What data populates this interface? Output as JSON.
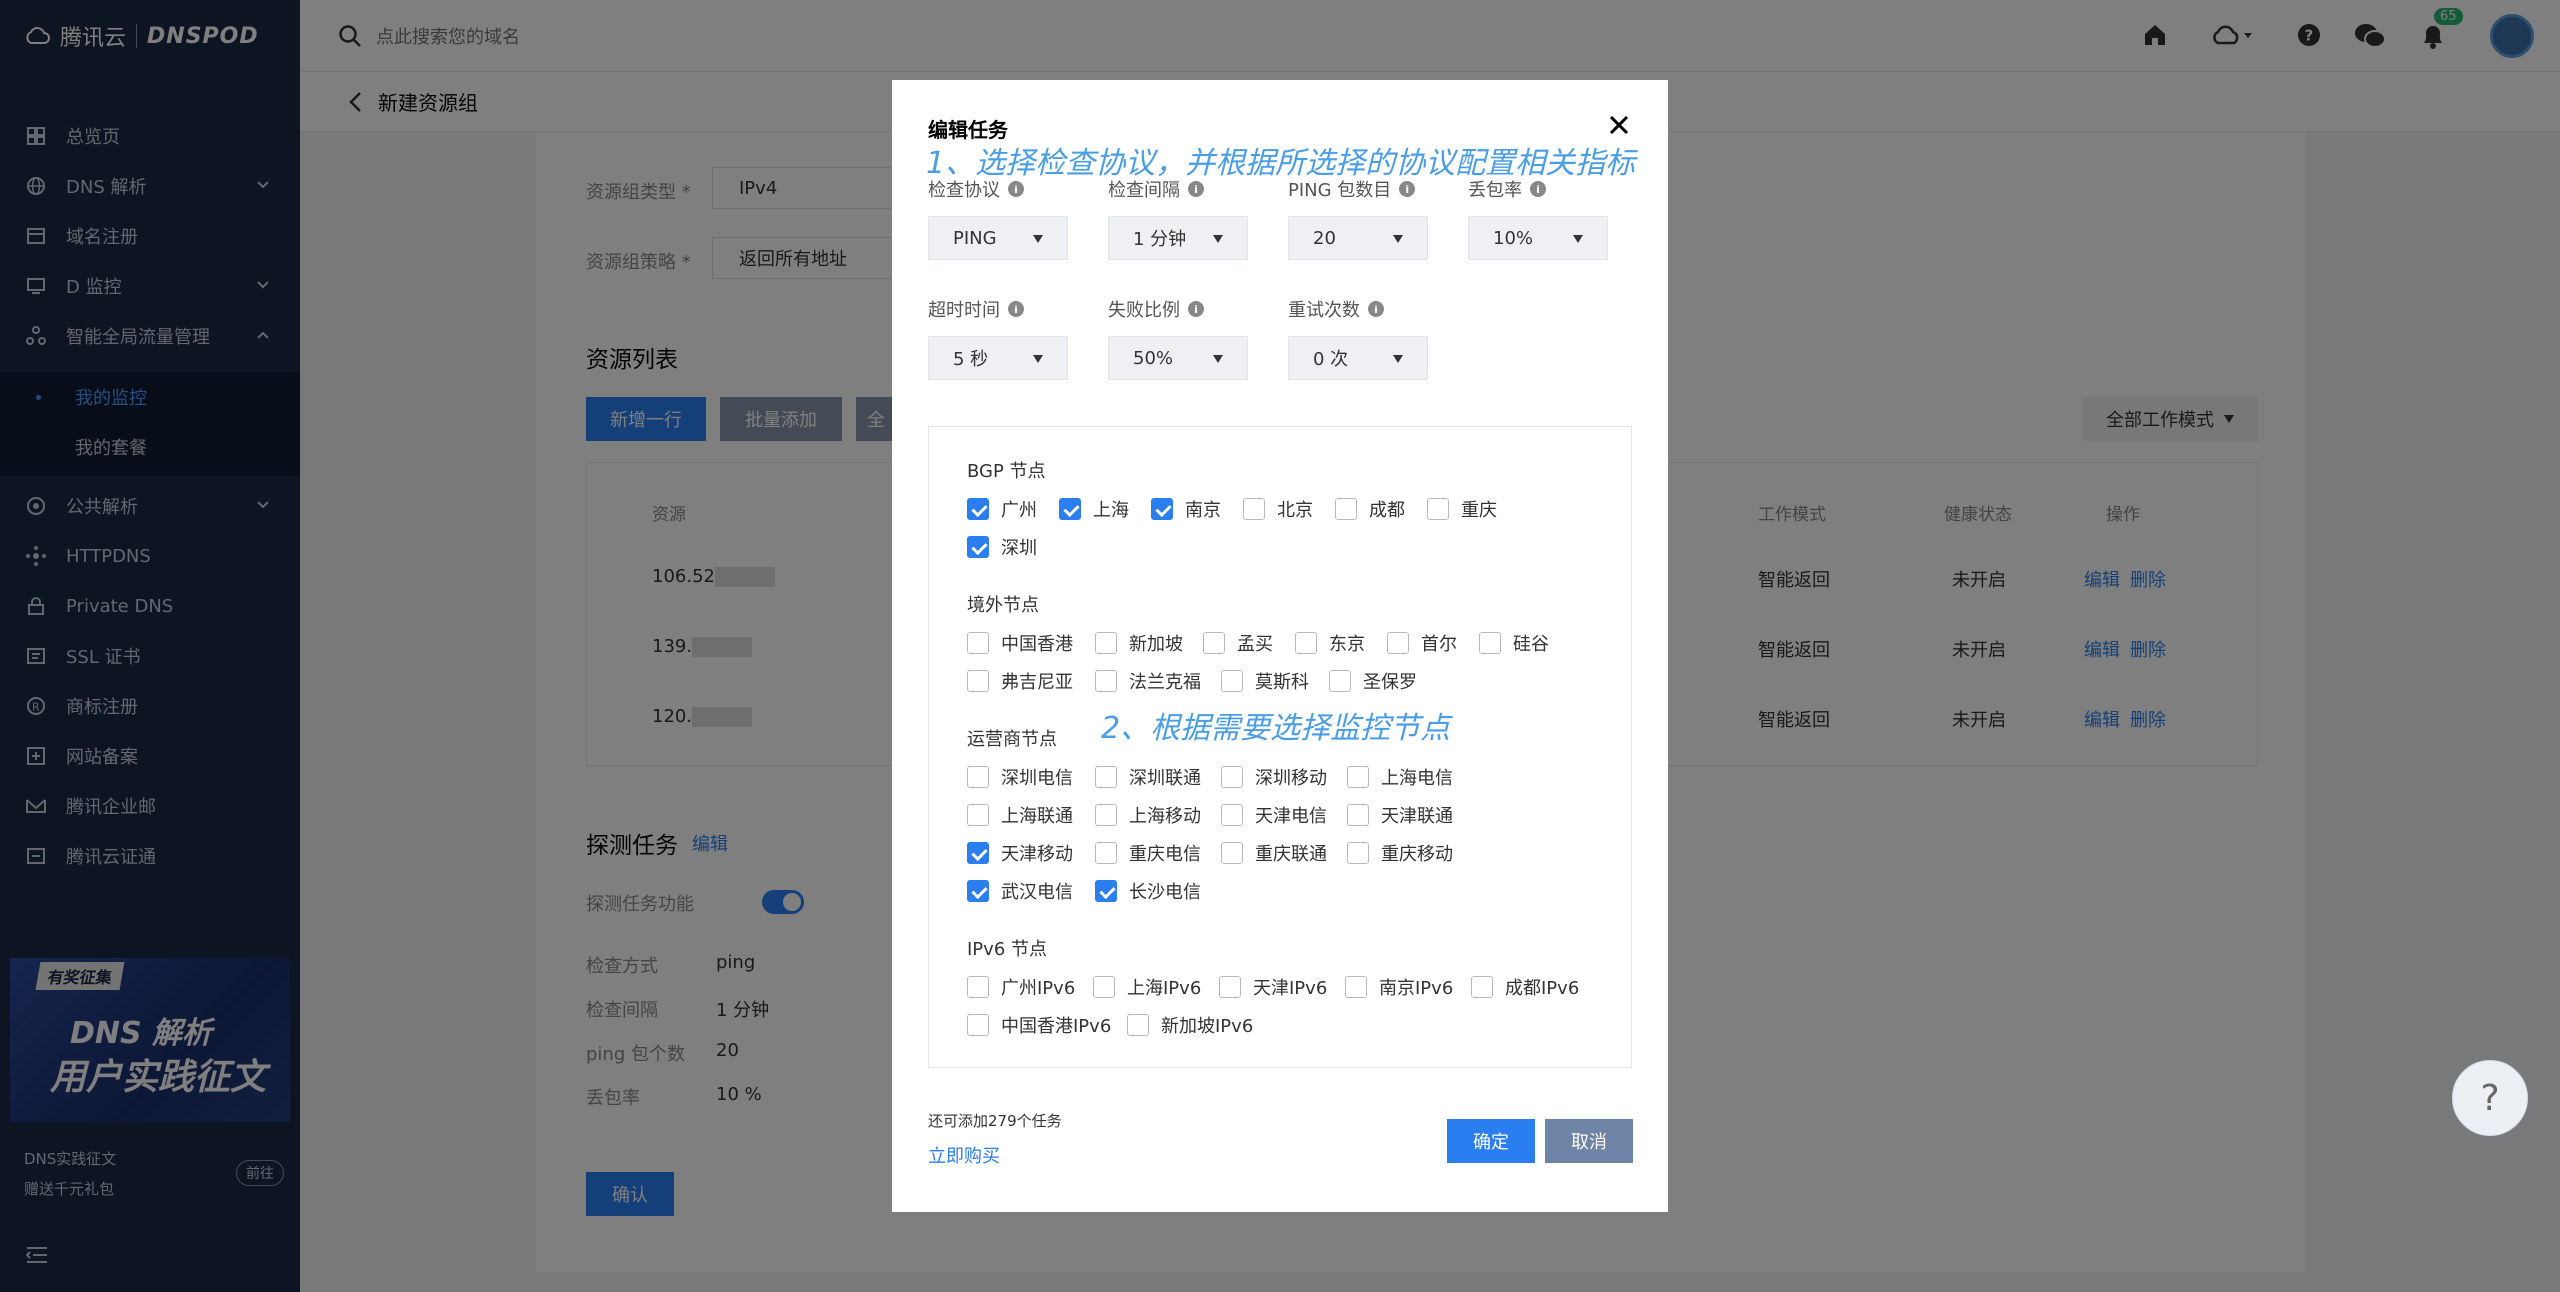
{
  "brand": {
    "name1": "腾讯云",
    "name2": "DNSPOD"
  },
  "sidebar": {
    "items": [
      {
        "label": "总览页"
      },
      {
        "label": "DNS 解析"
      },
      {
        "label": "域名注册"
      },
      {
        "label": "D 监控"
      },
      {
        "label": "智能全局流量管理"
      },
      {
        "label": "公共解析"
      },
      {
        "label": "HTTPDNS"
      },
      {
        "label": "Private DNS"
      },
      {
        "label": "SSL 证书"
      },
      {
        "label": "商标注册"
      },
      {
        "label": "网站备案"
      },
      {
        "label": "腾讯企业邮"
      },
      {
        "label": "腾讯云证通"
      }
    ],
    "subitems": [
      {
        "label": "我的监控"
      },
      {
        "label": "我的套餐"
      }
    ],
    "promo": {
      "tag": "有奖征集",
      "title1": "DNS 解析",
      "title2": "用户实践征文",
      "line1": "DNS实践征文",
      "line2": "赠送千元礼包",
      "button": "前往"
    }
  },
  "header": {
    "search_placeholder": "点此搜索您的域名",
    "notification_count": "65"
  },
  "page": {
    "back_title": "新建资源组",
    "type_label": "资源组类型 *",
    "type_value": "IPv4",
    "strategy_label": "资源组策略 *",
    "strategy_value": "返回所有地址",
    "list_title": "资源列表",
    "add_row": "新增一行",
    "batch_add": "批量添加",
    "all": "全",
    "mode_select": "全部工作模式",
    "table_headers": {
      "resource": "资源",
      "mode": "工作模式",
      "health": "健康状态",
      "ops": "操作"
    },
    "rows": [
      {
        "ip": "106.52",
        "mode": "智能返回",
        "health": "未开启",
        "edit": "编辑",
        "del": "删除"
      },
      {
        "ip": "139.",
        "mode": "智能返回",
        "health": "未开启",
        "edit": "编辑",
        "del": "删除"
      },
      {
        "ip": "120.",
        "mode": "智能返回",
        "health": "未开启",
        "edit": "编辑",
        "del": "删除"
      }
    ],
    "probe_title": "探测任务",
    "probe_edit": "编辑",
    "probe_fn_label": "探测任务功能",
    "check_method_label": "检查方式",
    "check_method": "ping",
    "interval_label": "检查间隔",
    "interval": "1 分钟",
    "ping_count_label": "ping 包个数",
    "ping_count": "20",
    "loss_label": "丢包率",
    "loss": "10 %",
    "confirm": "确认"
  },
  "modal": {
    "title": "编辑任务",
    "annotation1": "1、选择检查协议，并根据所选择的协议配置相关指标",
    "annotation2": "2、根据需要选择监控节点",
    "fields": [
      {
        "label": "检查协议",
        "value": "PING"
      },
      {
        "label": "检查间隔",
        "value": "1 分钟"
      },
      {
        "label": "PING 包数目",
        "value": "20"
      },
      {
        "label": "丢包率",
        "value": "10%"
      },
      {
        "label": "超时时间",
        "value": "5 秒"
      },
      {
        "label": "失败比例",
        "value": "50%"
      },
      {
        "label": "重试次数",
        "value": "0 次"
      }
    ],
    "groups": {
      "bgp": {
        "title": "BGP 节点",
        "nodes": [
          {
            "label": "广州",
            "checked": true
          },
          {
            "label": "上海",
            "checked": true
          },
          {
            "label": "南京",
            "checked": true
          },
          {
            "label": "北京",
            "checked": false
          },
          {
            "label": "成都",
            "checked": false
          },
          {
            "label": "重庆",
            "checked": false
          },
          {
            "label": "深圳",
            "checked": true
          }
        ]
      },
      "overseas": {
        "title": "境外节点",
        "nodes": [
          {
            "label": "中国香港",
            "checked": false
          },
          {
            "label": "新加坡",
            "checked": false
          },
          {
            "label": "孟买",
            "checked": false
          },
          {
            "label": "东京",
            "checked": false
          },
          {
            "label": "首尔",
            "checked": false
          },
          {
            "label": "硅谷",
            "checked": false
          },
          {
            "label": "弗吉尼亚",
            "checked": false
          },
          {
            "label": "法兰克福",
            "checked": false
          },
          {
            "label": "莫斯科",
            "checked": false
          },
          {
            "label": "圣保罗",
            "checked": false
          }
        ]
      },
      "isp": {
        "title": "运营商节点",
        "nodes": [
          {
            "label": "深圳电信",
            "checked": false
          },
          {
            "label": "深圳联通",
            "checked": false
          },
          {
            "label": "深圳移动",
            "checked": false
          },
          {
            "label": "上海电信",
            "checked": false
          },
          {
            "label": "上海联通",
            "checked": false
          },
          {
            "label": "上海移动",
            "checked": false
          },
          {
            "label": "天津电信",
            "checked": false
          },
          {
            "label": "天津联通",
            "checked": false
          },
          {
            "label": "天津移动",
            "checked": true
          },
          {
            "label": "重庆电信",
            "checked": false
          },
          {
            "label": "重庆联通",
            "checked": false
          },
          {
            "label": "重庆移动",
            "checked": false
          },
          {
            "label": "武汉电信",
            "checked": true
          },
          {
            "label": "长沙电信",
            "checked": true
          }
        ]
      },
      "ipv6": {
        "title": "IPv6 节点",
        "nodes": [
          {
            "label": "广州IPv6",
            "checked": false
          },
          {
            "label": "上海IPv6",
            "checked": false
          },
          {
            "label": "天津IPv6",
            "checked": false
          },
          {
            "label": "南京IPv6",
            "checked": false
          },
          {
            "label": "成都IPv6",
            "checked": false
          },
          {
            "label": "中国香港IPv6",
            "checked": false
          },
          {
            "label": "新加坡IPv6",
            "checked": false
          }
        ]
      }
    },
    "quota_text": "还可添加279个任务",
    "buy_link": "立即购买",
    "ok": "确定",
    "cancel": "取消"
  },
  "help_fab": "?",
  "colors": {
    "accent": "#2a7ef0",
    "sidebar_bg": "#1b2a47",
    "annotation": "#4a9ee8"
  }
}
